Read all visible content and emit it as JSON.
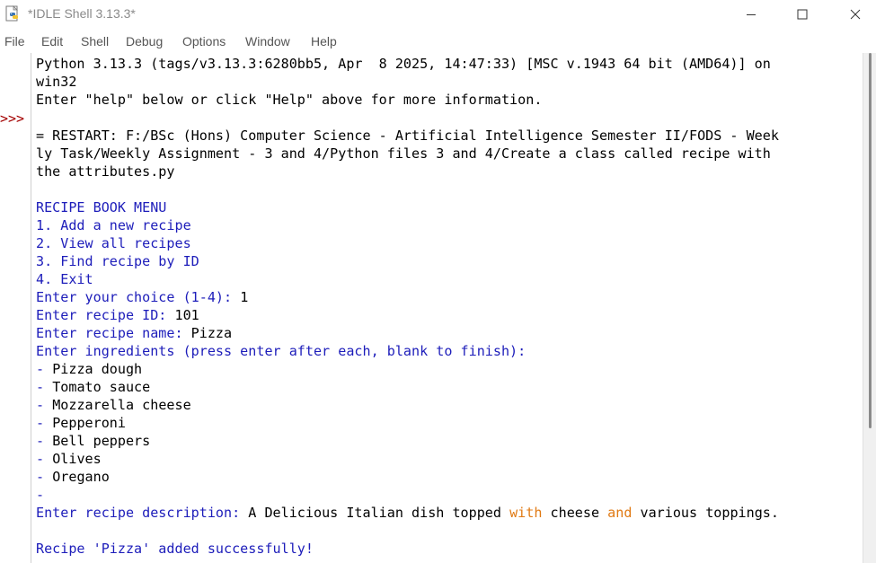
{
  "window": {
    "title": "*IDLE Shell 3.13.3*",
    "icon": "python-idle-icon"
  },
  "menu": {
    "items": [
      "File",
      "Edit",
      "Shell",
      "Debug",
      "Options",
      "Window",
      "Help"
    ]
  },
  "shell": {
    "prompt": ">>>",
    "lines": [
      {
        "text": "Python 3.13.3 (tags/v3.13.3:6280bb5, Apr  8 2025, 14:47:33) [MSC v.1943 64 bit (AMD64)] on",
        "kind": "inp"
      },
      {
        "text": "win32",
        "kind": "inp"
      },
      {
        "text": "Enter \"help\" below or click \"Help\" above for more information.",
        "kind": "inp"
      },
      {
        "text": "",
        "kind": "inp"
      },
      {
        "text": "= RESTART: F:/BSc (Hons) Computer Science - Artificial Intelligence Semester II/FODS - Week",
        "kind": "inp"
      },
      {
        "text": "ly Task/Weekly Assignment - 3 and 4/Python files 3 and 4/Create a class called recipe with",
        "kind": "inp"
      },
      {
        "text": "the attributes.py",
        "kind": "inp"
      },
      {
        "text": "",
        "kind": "inp"
      },
      {
        "text": "RECIPE BOOK MENU",
        "kind": "out"
      },
      {
        "text": "1. Add a new recipe",
        "kind": "out"
      },
      {
        "text": "2. View all recipes",
        "kind": "out"
      },
      {
        "text": "3. Find recipe by ID",
        "kind": "out"
      },
      {
        "text": "4. Exit",
        "kind": "out"
      },
      {
        "prefix": "Enter your choice (1-4): ",
        "value": "1",
        "kind": "prompt"
      },
      {
        "prefix": "Enter recipe ID: ",
        "value": "101",
        "kind": "prompt"
      },
      {
        "prefix": "Enter recipe name: ",
        "value": "Pizza",
        "kind": "prompt"
      },
      {
        "text": "Enter ingredients (press enter after each, blank to finish):",
        "kind": "out"
      },
      {
        "prefix": "- ",
        "value": "Pizza dough",
        "kind": "prompt"
      },
      {
        "prefix": "- ",
        "value": "Tomato sauce",
        "kind": "prompt"
      },
      {
        "prefix": "- ",
        "value": "Mozzarella cheese",
        "kind": "prompt"
      },
      {
        "prefix": "- ",
        "value": "Pepperoni",
        "kind": "prompt"
      },
      {
        "prefix": "- ",
        "value": "Bell peppers",
        "kind": "prompt"
      },
      {
        "prefix": "- ",
        "value": "Olives",
        "kind": "prompt"
      },
      {
        "prefix": "- ",
        "value": "Oregano",
        "kind": "prompt"
      },
      {
        "prefix": "-",
        "value": "",
        "kind": "prompt"
      },
      {
        "prefix": "Enter recipe description: ",
        "segments": [
          {
            "t": "A Delicious Italian dish topped ",
            "c": "inp"
          },
          {
            "t": "with",
            "c": "kw"
          },
          {
            "t": " cheese ",
            "c": "inp"
          },
          {
            "t": "and",
            "c": "kw"
          },
          {
            "t": " various toppings.",
            "c": "inp"
          }
        ],
        "kind": "desc"
      },
      {
        "text": "",
        "kind": "inp"
      },
      {
        "text": "Recipe 'Pizza' added successfully!",
        "kind": "out"
      }
    ]
  },
  "colors": {
    "output": "#1d1dba",
    "input": "#000000",
    "keyword": "#e07a14",
    "prompt": "#a30000"
  }
}
